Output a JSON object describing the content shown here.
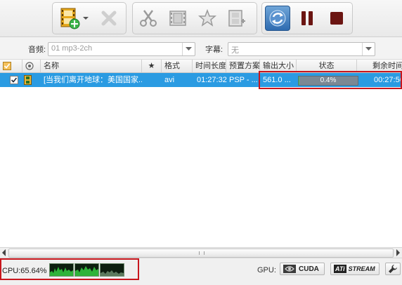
{
  "options": {
    "audio_label": "音频:",
    "audio_value": "01 mp3-2ch",
    "subtitle_label": "字幕:",
    "subtitle_value": "无"
  },
  "table": {
    "columns": [
      "名称",
      "★",
      "格式",
      "时间长度",
      "预置方案",
      "输出大小",
      "状态",
      "剩余时间"
    ],
    "rows": [
      {
        "checked": true,
        "name": "[当我们离开地球：美国国家...",
        "format": "avi",
        "duration": "01:27:32",
        "preset": "PSP - ...",
        "output_size": "561.0 ...",
        "status_percent": 0.4,
        "status_text": "0.4%",
        "remaining": "00:27:56"
      }
    ]
  },
  "statusbar": {
    "cpu_text": "CPU:65.64%",
    "gpu_label": "GPU:",
    "cuda_label": "CUDA",
    "ati_label": "STREAM",
    "ati_logo": "ATi"
  },
  "colors": {
    "selection": "#2a9be2",
    "highlight_box": "#c8161d",
    "progress_fill": "#3bd15a"
  }
}
